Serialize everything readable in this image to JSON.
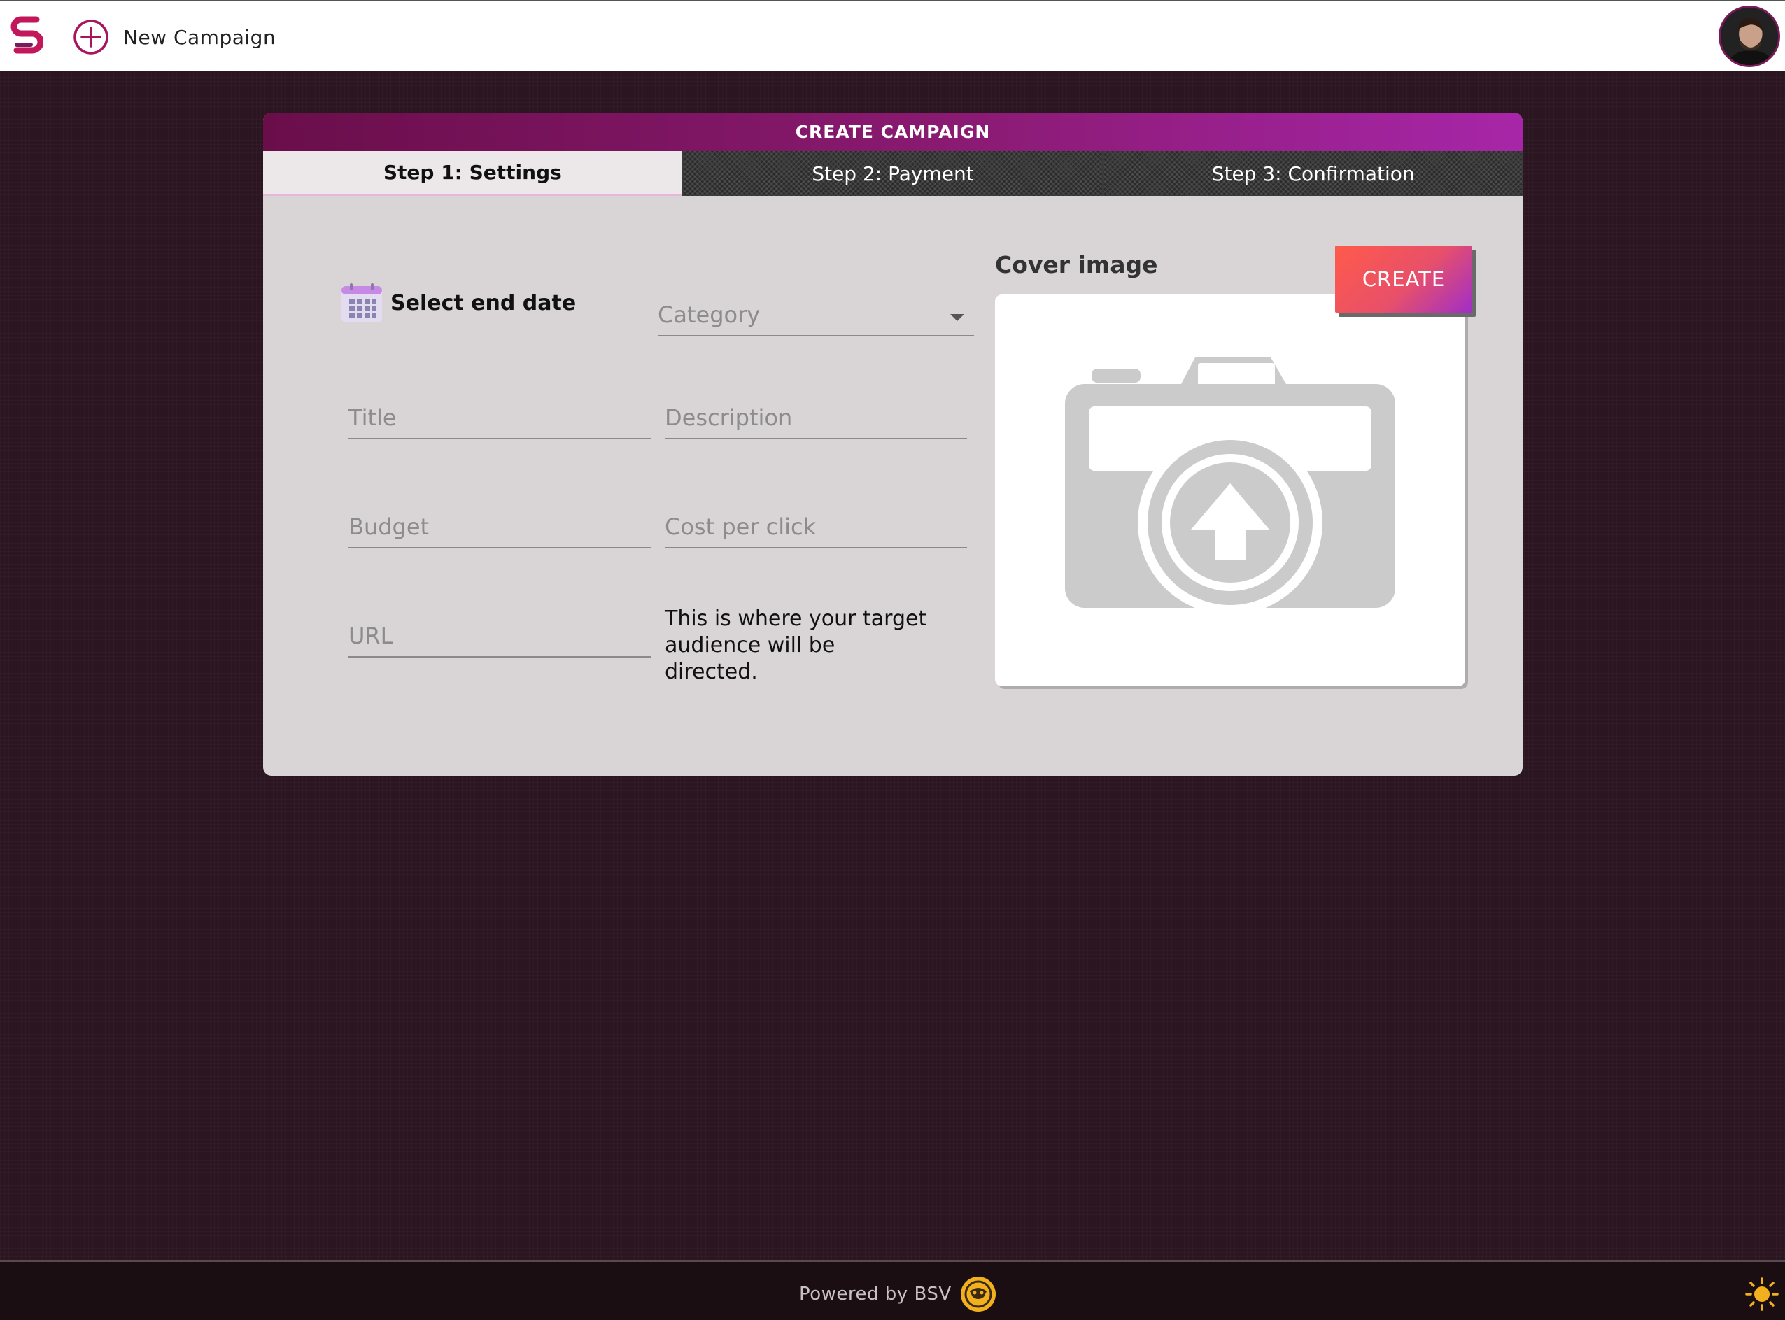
{
  "header": {
    "new_campaign_label": "New Campaign"
  },
  "card": {
    "title": "CREATE CAMPAIGN",
    "tabs": [
      {
        "label": "Step 1: Settings",
        "active": true
      },
      {
        "label": "Step 2: Payment",
        "active": false
      },
      {
        "label": "Step 3: Confirmation",
        "active": false
      }
    ],
    "date_picker_label": "Select end date",
    "fields": {
      "category": "Category",
      "title": "Title",
      "description": "Description",
      "budget": "Budget",
      "cost_per_click": "Cost per click",
      "url": "URL"
    },
    "url_helper": "This is where your target audience will be directed.",
    "cover_image_label": "Cover image",
    "create_button": "CREATE"
  },
  "footer": {
    "powered_by": "Powered by BSV"
  },
  "colors": {
    "accent": "#8a1a72",
    "button_gradient_start": "#ff5a4a",
    "button_gradient_end": "#a02ec8",
    "page_background": "#2a1520",
    "card_background": "#d9d4d6"
  }
}
